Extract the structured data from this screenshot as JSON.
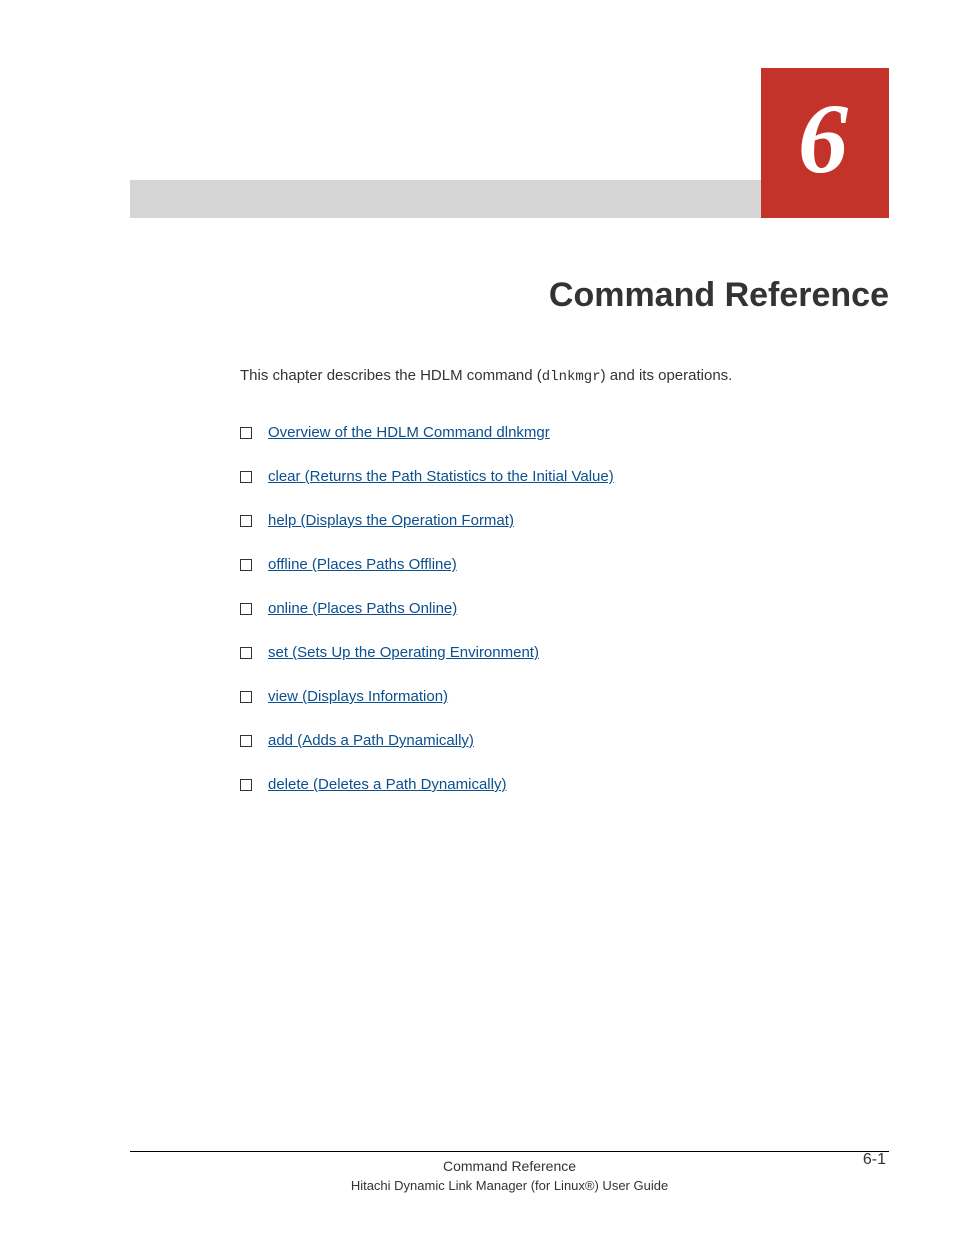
{
  "chapter": {
    "number": "6",
    "title": "Command Reference"
  },
  "intro": {
    "prefix": "This chapter describes the HDLM command (",
    "command": "dlnkmgr",
    "suffix": ") and its operations."
  },
  "toc": [
    {
      "label": "Overview of the HDLM Command dlnkmgr"
    },
    {
      "label": "clear (Returns the Path Statistics to the Initial Value)"
    },
    {
      "label": "help (Displays the Operation Format)"
    },
    {
      "label": "offline (Places Paths Offline)"
    },
    {
      "label": "online (Places Paths Online)"
    },
    {
      "label": "set (Sets Up the Operating Environment)"
    },
    {
      "label": "view (Displays Information)"
    },
    {
      "label": "add (Adds a Path Dynamically)"
    },
    {
      "label": "delete (Deletes a Path Dynamically)"
    }
  ],
  "footer": {
    "section": "Command Reference",
    "doc_title": "Hitachi Dynamic Link Manager (for Linux®) User Guide",
    "page_number": "6-1"
  }
}
